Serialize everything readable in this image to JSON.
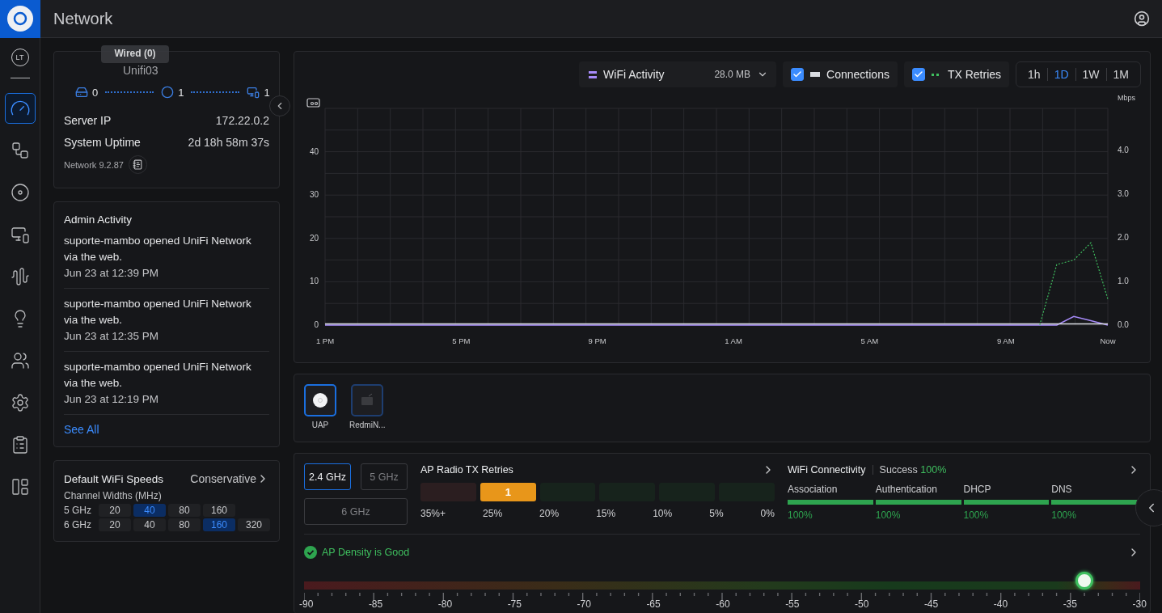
{
  "header": {
    "title": "Network"
  },
  "sidebar": {
    "avatar": "LT",
    "items": [
      {
        "selected": true
      },
      {
        "selected": false
      },
      {
        "selected": false
      },
      {
        "selected": false
      },
      {
        "selected": false
      },
      {
        "selected": false
      },
      {
        "selected": false
      },
      {
        "selected": false
      },
      {
        "selected": false
      },
      {
        "selected": false
      }
    ]
  },
  "server": {
    "tooltip": "Wired (0)",
    "hostname": "Unifi03",
    "counts": [
      "0",
      "1",
      "1"
    ],
    "rows": [
      {
        "label": "Server IP",
        "value": "172.22.0.2"
      },
      {
        "label": "System Uptime",
        "value": "2d 18h 58m 37s"
      }
    ],
    "version": "Network 9.2.87"
  },
  "admin_activity": {
    "title": "Admin Activity",
    "entries": [
      {
        "text": "suporte-mambo opened UniFi Network via the web.",
        "time": "Jun 23 at 12:39 PM"
      },
      {
        "text": "suporte-mambo opened UniFi Network via the web.",
        "time": "Jun 23 at 12:35 PM"
      },
      {
        "text": "suporte-mambo opened UniFi Network via the web.",
        "time": "Jun 23 at 12:19 PM"
      }
    ],
    "link": "See All"
  },
  "wifi_speeds": {
    "title": "Default WiFi Speeds",
    "mode": "Conservative",
    "subtitle": "Channel Widths (MHz)",
    "rows": [
      {
        "band": "5 GHz",
        "options": [
          {
            "label": "20",
            "selected": false
          },
          {
            "label": "40",
            "selected": true
          },
          {
            "label": "80",
            "selected": false
          },
          {
            "label": "160",
            "selected": false
          }
        ]
      },
      {
        "band": "6 GHz",
        "options": [
          {
            "label": "20",
            "selected": false
          },
          {
            "label": "40",
            "selected": false
          },
          {
            "label": "80",
            "selected": false
          },
          {
            "label": "160",
            "selected": true
          },
          {
            "label": "320",
            "selected": false
          }
        ]
      }
    ]
  },
  "chart_toolbar": {
    "activity": {
      "value": "28.0 MB"
    },
    "toggles": [
      {
        "checked": true
      },
      {
        "checked": true
      }
    ],
    "ranges": [
      {
        "label": "1h",
        "selected": false
      },
      {
        "label": "1D",
        "selected": true
      },
      {
        "label": "1W",
        "selected": false
      },
      {
        "label": "1M",
        "selected": false
      }
    ]
  },
  "chart": {
    "right_axis": {
      "label": "Mbps",
      "ticks": [
        "4.0",
        "3.0",
        "2.0",
        "1.0",
        "0.0"
      ]
    },
    "chart_data": {
      "type": "line",
      "categories": [
        "1 PM",
        null,
        null,
        null,
        null,
        null,
        null,
        null,
        "5 PM",
        null,
        null,
        null,
        null,
        null,
        null,
        null,
        "9 PM",
        null,
        null,
        null,
        null,
        null,
        null,
        null,
        "1 AM",
        null,
        null,
        null,
        null,
        null,
        null,
        null,
        "5 AM",
        null,
        null,
        null,
        null,
        null,
        null,
        null,
        "9 AM",
        null,
        null,
        null,
        null,
        null,
        "Now"
      ],
      "ylim": [
        0,
        50
      ],
      "grid": true,
      "yticks": [
        0,
        10,
        20,
        30,
        40
      ],
      "series": [
        {
          "name": "WiFi Activity",
          "color": "#a78bfa",
          "values": [
            0,
            0,
            0,
            0,
            0,
            0,
            0,
            0,
            0,
            0,
            0,
            0,
            0,
            0,
            0,
            0,
            0,
            0,
            0,
            0,
            0,
            0,
            0,
            0,
            0,
            0,
            0,
            0,
            0,
            0,
            0,
            0,
            0,
            0,
            0,
            0,
            0,
            0,
            0,
            0,
            0,
            0,
            0,
            0,
            2,
            1,
            0
          ]
        },
        {
          "name": "Connections",
          "color": "#d9dce1",
          "values": [
            0.3,
            0.3,
            0.3,
            0.3,
            0.3,
            0.3,
            0.3,
            0.3,
            0.3,
            0.3,
            0.3,
            0.3,
            0.3,
            0.3,
            0.3,
            0.3,
            0.3,
            0.3,
            0.3,
            0.3,
            0.3,
            0.3,
            0.3,
            0.3,
            0.3,
            0.3,
            0.3,
            0.3,
            0.3,
            0.3,
            0.3,
            0.3,
            0.3,
            0.3,
            0.3,
            0.3,
            0.3,
            0.3,
            0.3,
            0.3,
            0.3,
            0.3,
            0.3,
            0.3,
            0.3,
            0.3,
            0.3
          ]
        },
        {
          "name": "TX Retries",
          "color": "#3fbf5f",
          "line_style": "dashed",
          "values": [
            null,
            null,
            null,
            null,
            null,
            null,
            null,
            null,
            null,
            null,
            null,
            null,
            null,
            null,
            null,
            null,
            null,
            null,
            null,
            null,
            null,
            null,
            null,
            null,
            null,
            null,
            null,
            null,
            null,
            null,
            null,
            null,
            null,
            null,
            null,
            null,
            null,
            null,
            null,
            null,
            null,
            null,
            0,
            14,
            15,
            19,
            6
          ]
        }
      ]
    }
  },
  "devices": [
    {
      "label": "UAP",
      "selected": true
    },
    {
      "label": "RedmiN...",
      "selected": false
    }
  ],
  "bands": [
    {
      "label": "2.4 GHz",
      "selected": true
    },
    {
      "label": "5 GHz",
      "selected": false
    },
    {
      "label": "6 GHz",
      "selected": false
    }
  ],
  "tx_retries": {
    "title": "AP Radio TX Retries",
    "segments": [
      {
        "color": "#2b1e20"
      },
      {
        "color": "#e8961a",
        "count": "1"
      },
      {
        "color": "#17231c"
      },
      {
        "color": "#17231c"
      },
      {
        "color": "#17231c"
      },
      {
        "color": "#17231c"
      }
    ],
    "labels": [
      "35%+",
      "25%",
      "20%",
      "15%",
      "10%",
      "5%",
      "0%"
    ]
  },
  "connectivity": {
    "title": "WiFi Connectivity",
    "success_label": "Success",
    "success_value": "100%",
    "metrics": [
      {
        "label": "Association",
        "level": 1,
        "value": "100%"
      },
      {
        "label": "Authentication",
        "level": 1,
        "value": "100%"
      },
      {
        "label": "DHCP",
        "level": 1,
        "value": "100%"
      },
      {
        "label": "DNS",
        "level": 1,
        "value": "100%"
      }
    ]
  },
  "density": {
    "status": "AP Density is Good",
    "scale": [
      "-90",
      "-85",
      "-80",
      "-75",
      "-70",
      "-65",
      "-60",
      "-55",
      "-50",
      "-45",
      "-40",
      "-35",
      "-30"
    ],
    "level": 0.933
  }
}
